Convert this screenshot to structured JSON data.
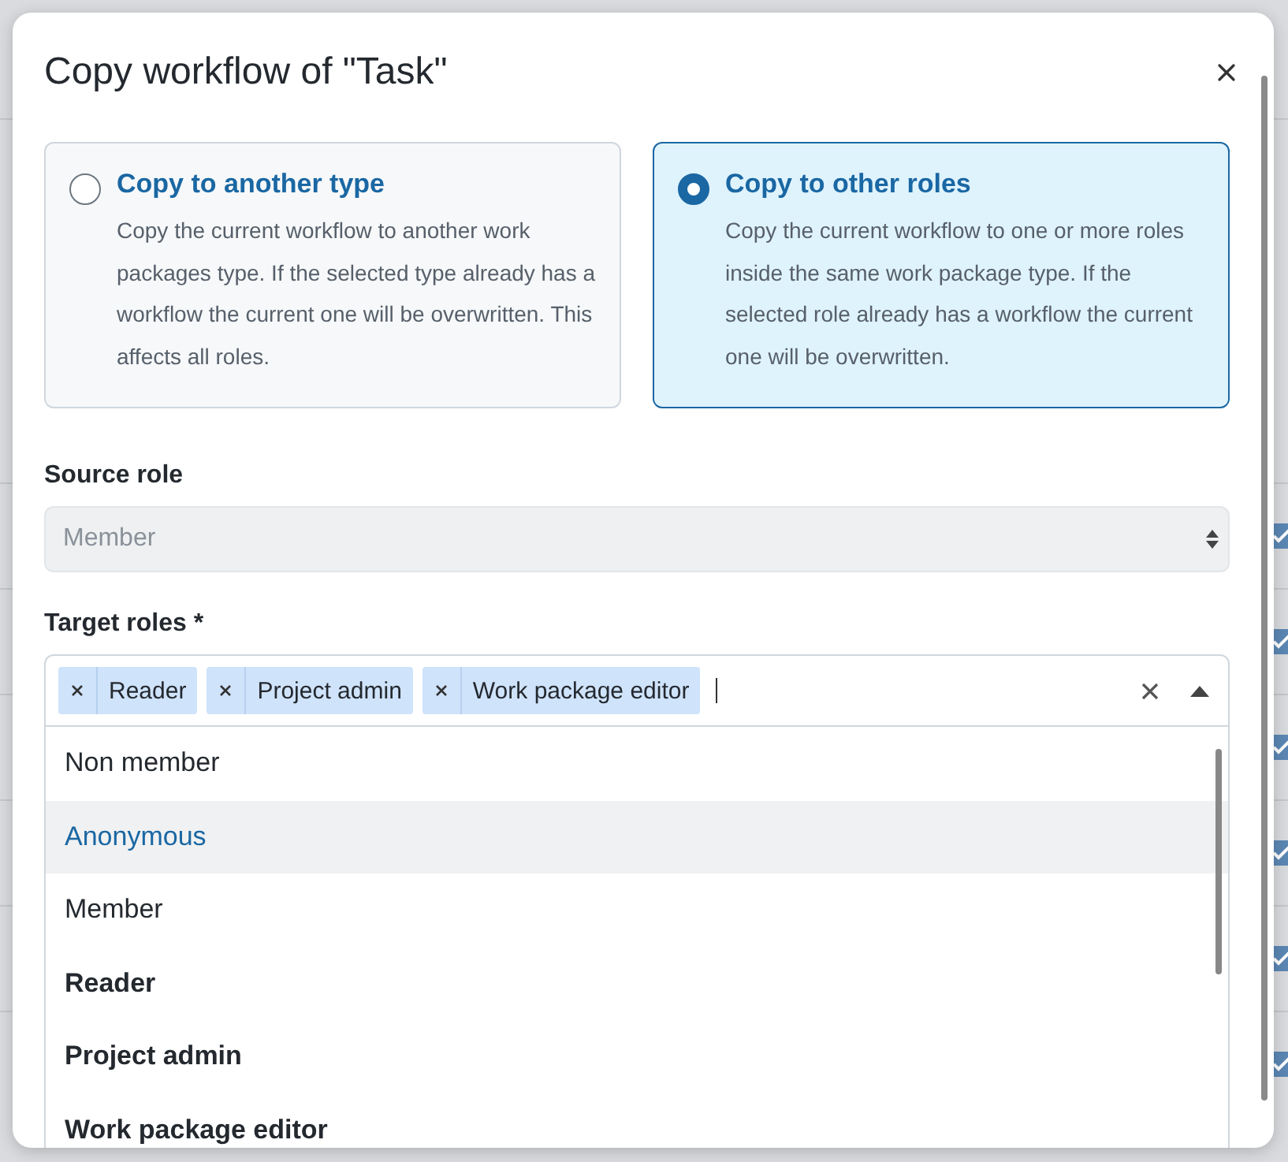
{
  "background": {
    "checkboxes": [
      {
        "checked": true
      },
      {
        "checked": true
      },
      {
        "checked": true
      },
      {
        "checked": true
      },
      {
        "checked": true
      },
      {
        "checked": true
      }
    ]
  },
  "dialog": {
    "title": "Copy workflow of \"Task\"",
    "options": [
      {
        "title": "Copy to another type",
        "description": "Copy the current workflow to another work packages type. If the selected type already has a workflow the current one will be overwritten. This affects all roles.",
        "selected": false
      },
      {
        "title": "Copy to other roles",
        "description": "Copy the current workflow to one or more roles inside the same work package type. If the selected role already has a workflow the current one will be overwritten.",
        "selected": true
      }
    ],
    "source_role": {
      "label": "Source role",
      "value": "Member",
      "disabled": true
    },
    "target_roles": {
      "label": "Target roles *",
      "chips": [
        "Reader",
        "Project admin",
        "Work package editor"
      ],
      "dropdown": [
        {
          "label": "Non member",
          "chosen": false,
          "highlighted": false
        },
        {
          "label": "Anonymous",
          "chosen": false,
          "highlighted": true
        },
        {
          "label": "Member",
          "chosen": false,
          "highlighted": false
        },
        {
          "label": "Reader",
          "chosen": true,
          "highlighted": false
        },
        {
          "label": "Project admin",
          "chosen": true,
          "highlighted": false
        },
        {
          "label": "Work package editor",
          "chosen": true,
          "highlighted": false
        }
      ]
    }
  }
}
